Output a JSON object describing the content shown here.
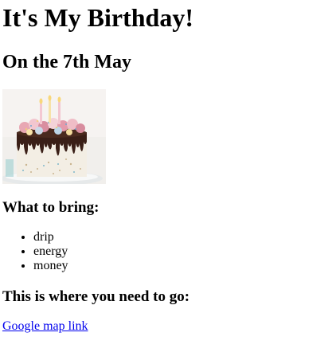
{
  "heading": "It's My Birthday!",
  "subheading": "On the 7th May",
  "image": {
    "alt": "birthday cake",
    "icon": "birthday-cake-image"
  },
  "bring": {
    "heading": "What to bring:",
    "items": [
      "drip",
      "energy",
      "money"
    ]
  },
  "location": {
    "heading": "This is where you need to go:",
    "link_text": "Google map link"
  },
  "colors": {
    "link": "#0000ee",
    "text": "#000000",
    "background": "#ffffff"
  }
}
